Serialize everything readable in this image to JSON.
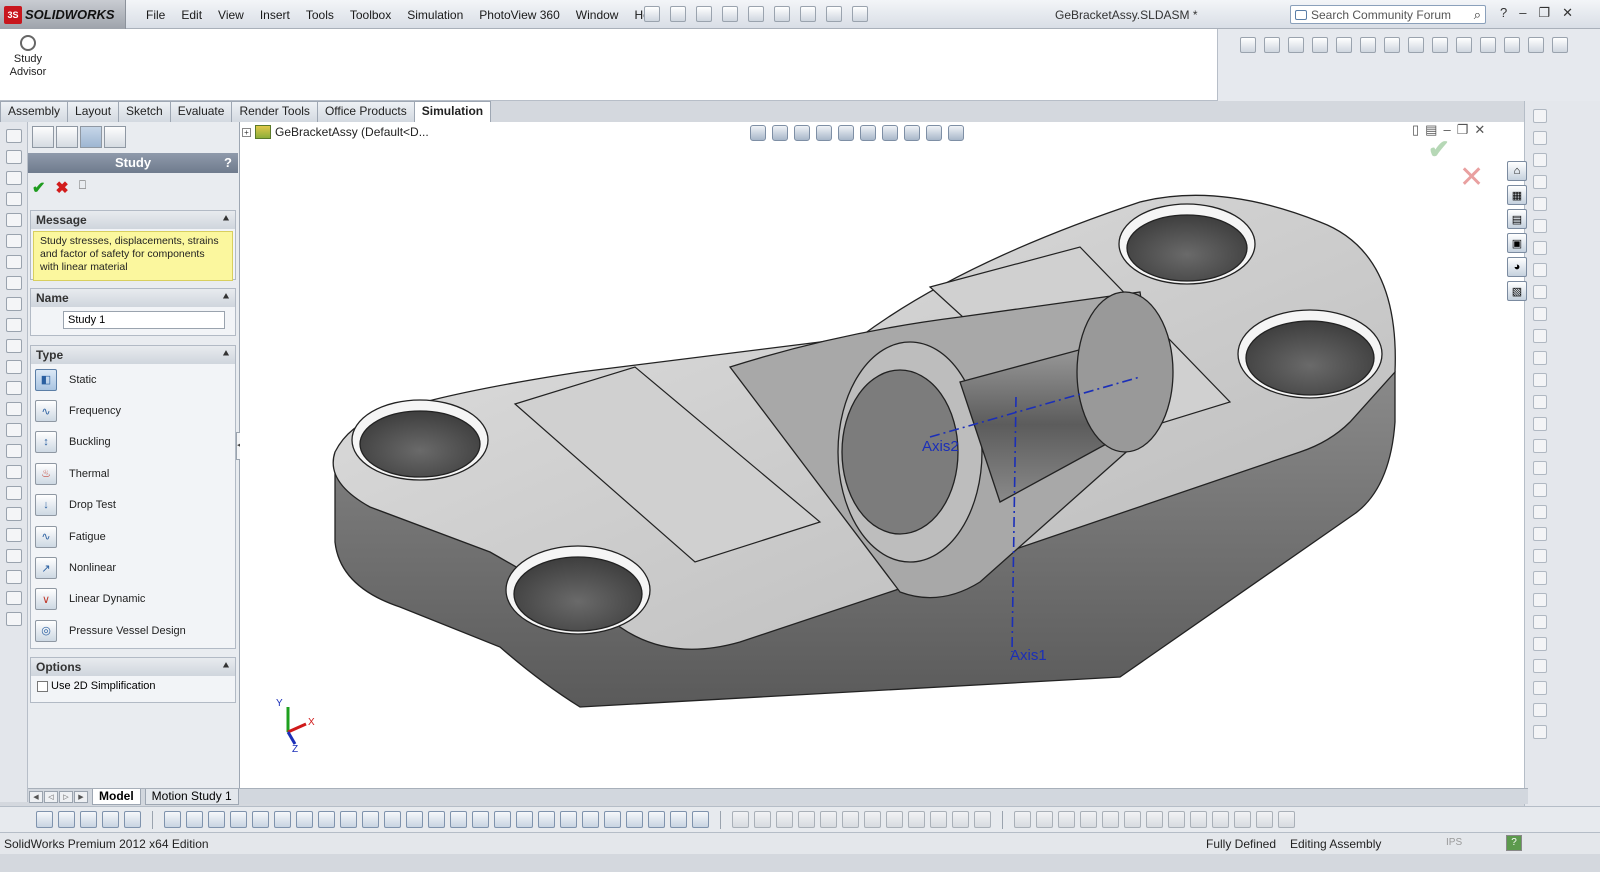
{
  "app": {
    "brand": "SOLIDWORKS",
    "brand_badge": "3S",
    "document_title": "GeBracketAssy.SLDASM *"
  },
  "menu": [
    "File",
    "Edit",
    "View",
    "Insert",
    "Tools",
    "Toolbox",
    "Simulation",
    "PhotoView 360",
    "Window",
    "Help"
  ],
  "search": {
    "placeholder": "Search Community Forum"
  },
  "command_manager": {
    "study_advisor": "Study Advisor"
  },
  "tabs": [
    {
      "label": "Assembly",
      "active": false
    },
    {
      "label": "Layout",
      "active": false
    },
    {
      "label": "Sketch",
      "active": false
    },
    {
      "label": "Evaluate",
      "active": false
    },
    {
      "label": "Render Tools",
      "active": false
    },
    {
      "label": "Office Products",
      "active": false
    },
    {
      "label": "Simulation",
      "active": true
    }
  ],
  "property_manager": {
    "title": "Study",
    "help": "?",
    "message": {
      "header": "Message",
      "text": "Study stresses, displacements, strains and factor of safety for components with linear material"
    },
    "name": {
      "header": "Name",
      "value": "Study 1"
    },
    "type": {
      "header": "Type",
      "items": [
        {
          "label": "Static",
          "icon": "static-study-icon",
          "selected": true
        },
        {
          "label": "Frequency",
          "icon": "frequency-study-icon",
          "selected": false
        },
        {
          "label": "Buckling",
          "icon": "buckling-study-icon",
          "selected": false
        },
        {
          "label": "Thermal",
          "icon": "thermal-study-icon",
          "selected": false
        },
        {
          "label": "Drop Test",
          "icon": "drop-test-study-icon",
          "selected": false
        },
        {
          "label": "Fatigue",
          "icon": "fatigue-study-icon",
          "selected": false
        },
        {
          "label": "Nonlinear",
          "icon": "nonlinear-study-icon",
          "selected": false
        },
        {
          "label": "Linear Dynamic",
          "icon": "linear-dynamic-study-icon",
          "selected": false
        },
        {
          "label": "Pressure Vessel Design",
          "icon": "pressure-vessel-study-icon",
          "selected": false
        }
      ]
    },
    "options": {
      "header": "Options",
      "checkbox_label": "Use 2D Simplification",
      "checked": false
    }
  },
  "tree": {
    "root": "GeBracketAssy  (Default<D..."
  },
  "viewport": {
    "axis_labels": [
      "Axis2",
      "Axis1"
    ],
    "triad": {
      "x": "X",
      "y": "Y",
      "z": "Z"
    }
  },
  "bottom_tabs": [
    {
      "label": "Model",
      "active": true
    },
    {
      "label": "Motion Study 1",
      "active": false
    }
  ],
  "status": {
    "edition": "SolidWorks Premium 2012 x64 Edition",
    "defined": "Fully Defined",
    "mode": "Editing Assembly",
    "units": "IPS",
    "help": "?"
  },
  "colors": {
    "accent": "#c8161d",
    "pm_header": "#7b8799",
    "message_bg": "#fbf79e",
    "ok": "#1f9c1f",
    "cancel": "#d21c1c"
  }
}
